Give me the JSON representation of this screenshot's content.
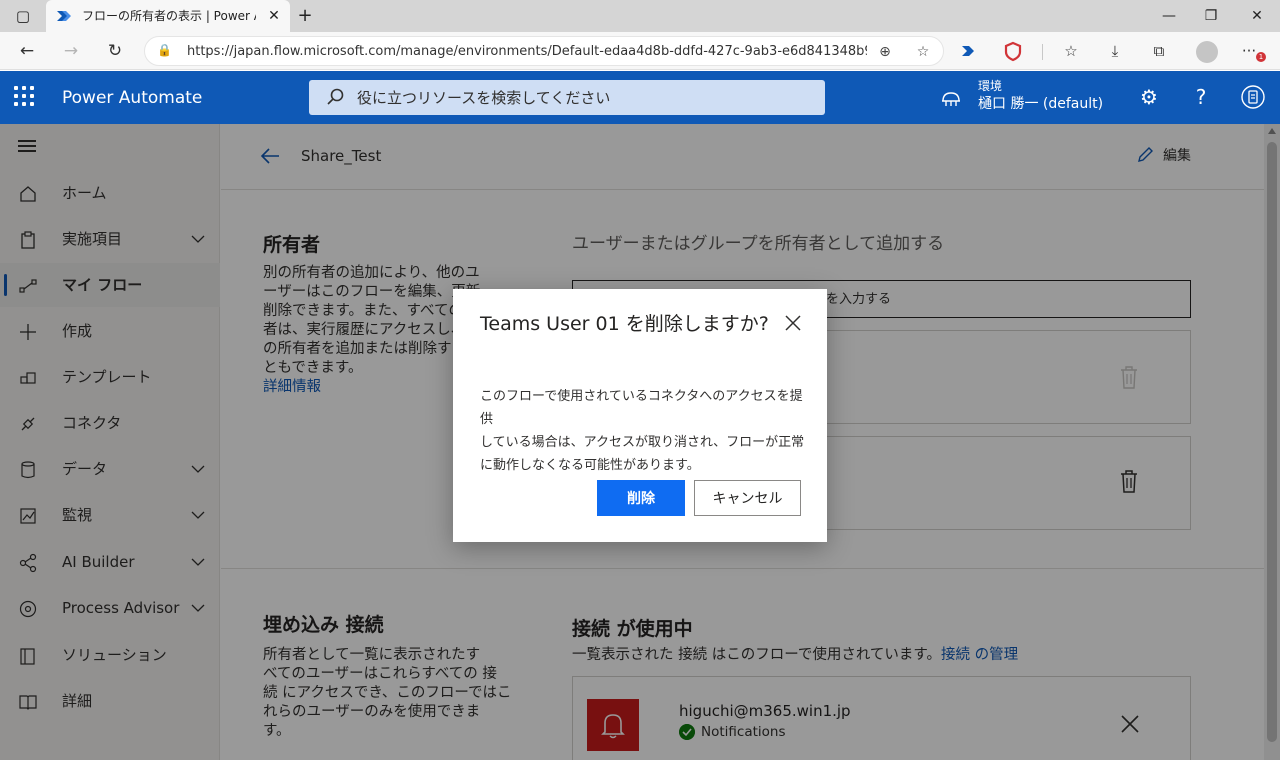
{
  "browser": {
    "tab_title": "フローの所有者の表示 | Power Automate",
    "url": "https://japan.flow.microsoft.com/manage/environments/Default-edaa4d8b-ddfd-427c-9ab3-e6d841348b9...",
    "notification_badge": "1"
  },
  "header": {
    "brand": "Power Automate",
    "search_placeholder": "役に立つリソースを検索してください",
    "env_label": "環境",
    "env_name": "樋口 勝一 (default)",
    "accent_color": "#0f59b6"
  },
  "sidebar": {
    "items": [
      {
        "label": "ホーム",
        "icon": "home-icon",
        "chevron": false
      },
      {
        "label": "実施項目",
        "icon": "clipboard-icon",
        "chevron": true
      },
      {
        "label": "マイ フロー",
        "icon": "flow-icon",
        "chevron": false,
        "active": true
      },
      {
        "label": "作成",
        "icon": "plus-icon",
        "chevron": false
      },
      {
        "label": "テンプレート",
        "icon": "template-icon",
        "chevron": false
      },
      {
        "label": "コネクタ",
        "icon": "connector-icon",
        "chevron": false
      },
      {
        "label": "データ",
        "icon": "database-icon",
        "chevron": true
      },
      {
        "label": "監視",
        "icon": "monitor-icon",
        "chevron": true
      },
      {
        "label": "AI Builder",
        "icon": "ai-builder-icon",
        "chevron": true
      },
      {
        "label": "Process Advisor",
        "icon": "process-advisor-icon",
        "chevron": true
      },
      {
        "label": "ソリューション",
        "icon": "solution-icon",
        "chevron": false
      },
      {
        "label": "詳細",
        "icon": "book-icon",
        "chevron": false
      }
    ]
  },
  "main": {
    "flow_name": "Share_Test",
    "edit_label": "編集",
    "owners": {
      "title": "所有者",
      "body_lines": [
        "別の所有者の追加により、他のユ",
        "ーザーはこのフローを編集、更新",
        "削除できます。また、すべての所",
        "者は、実行履歴にアクセスし、",
        "の所有者を追加または削除す",
        "ともできます。"
      ],
      "link": "詳細情報",
      "add_heading": "ユーザーまたはグループを所有者として追加する",
      "input_placeholder": "を入力する"
    },
    "embedded": {
      "title": "埋め込み 接続",
      "body_lines": [
        "所有者として一覧に表示されたす",
        "べてのユーザーはこれらすべての 接",
        "続 にアクセスでき、このフローではこ",
        "れらのユーザーのみを使用できま",
        "す。"
      ]
    },
    "connections": {
      "title": "接続 が使用中",
      "desc": "一覧表示された 接続 はこのフローで使用されています。",
      "manage_link": "接続 の管理",
      "email": "higuchi@m365.win1.jp",
      "type": "Notifications"
    }
  },
  "dialog": {
    "title": "Teams User 01 を削除しますか?",
    "body_lines": [
      "このフローで使用されているコネクタへのアクセスを提供",
      "している場合は、アクセスが取り消され、フローが正常",
      "に動作しなくなる可能性があります。"
    ],
    "confirm_label": "削除",
    "cancel_label": "キャンセル"
  }
}
